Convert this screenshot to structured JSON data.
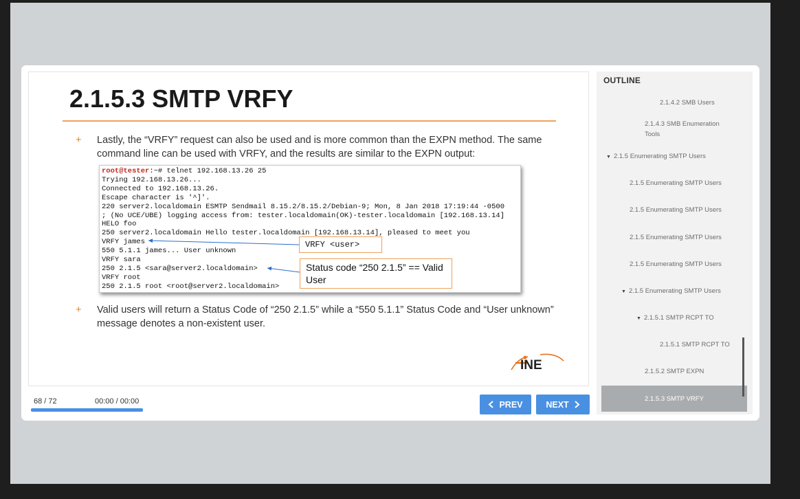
{
  "slide": {
    "title": "2.1.5.3 SMTP VRFY",
    "bullets": [
      {
        "marker": "+",
        "text": "Lastly, the “VRFY” request can also be used and is more common than the EXPN method. The same command line can be used with VRFY, and the results are similar to the EXPN output:"
      },
      {
        "marker": "+",
        "text": "Valid users will return a Status Code of “250 2.1.5” while a “550 5.1.1” Status Code and “User unknown” message denotes a non-existent user."
      }
    ],
    "terminal": {
      "prompt_user": "root@tester",
      "prompt_rest": ":~# telnet 192.168.13.26 25",
      "lines": [
        "Trying 192.168.13.26...",
        "Connected to 192.168.13.26.",
        "Escape character is '^]'.",
        "220 server2.localdomain ESMTP Sendmail 8.15.2/8.15.2/Debian-9; Mon, 8 Jan 2018 17:19:44 -0500",
        "; (No UCE/UBE) logging access from: tester.localdomain(OK)-tester.localdomain [192.168.13.14]",
        "HELO foo",
        "250 server2.localdomain Hello tester.localdomain [192.168.13.14], pleased to meet you",
        "VRFY james",
        "550 5.1.1 james... User unknown",
        "VRFY sara",
        "250 2.1.5 <sara@server2.localdomain>",
        "VRFY root",
        "250 2.1.5 root <root@server2.localdomain>"
      ]
    },
    "callouts": {
      "vrfy_user": "VRFY <user>",
      "status_code": "Status code “250 2.1.5” == Valid User"
    },
    "logo_text": "INE"
  },
  "player": {
    "slide_counter": "68 / 72",
    "time": "00:00 / 00:00",
    "progress": 0.944,
    "prev_label": "PREV",
    "next_label": "NEXT"
  },
  "outline": {
    "header": "OUTLINE",
    "items": [
      {
        "label": "2.1.4.2 SMB Users",
        "expanded": false
      },
      {
        "label": "2.1.4.3 SMB Enumeration Tools",
        "expanded": false
      },
      {
        "label": "2.1.5 Enumerating SMTP Users",
        "expanded": true
      },
      {
        "label": "2.1.5 Enumerating SMTP Users",
        "expanded": false
      },
      {
        "label": "2.1.5 Enumerating SMTP Users",
        "expanded": false
      },
      {
        "label": "2.1.5 Enumerating SMTP Users",
        "expanded": false
      },
      {
        "label": "2.1.5 Enumerating SMTP Users",
        "expanded": false
      },
      {
        "label": "2.1.5 Enumerating SMTP Users",
        "expanded": true
      },
      {
        "label": "2.1.5.1 SMTP RCPT TO",
        "expanded": true
      },
      {
        "label": "2.1.5.1 SMTP RCPT TO",
        "expanded": false
      },
      {
        "label": "2.1.5.2 SMTP EXPN",
        "expanded": false
      }
    ],
    "active_item": "2.1.5.3 SMTP VRFY"
  },
  "colors": {
    "accent_blue": "#4a90e2",
    "title_rule_orange": "#f0a05a",
    "prompt_red": "#c0271f",
    "outline_active": "#a9acae"
  }
}
